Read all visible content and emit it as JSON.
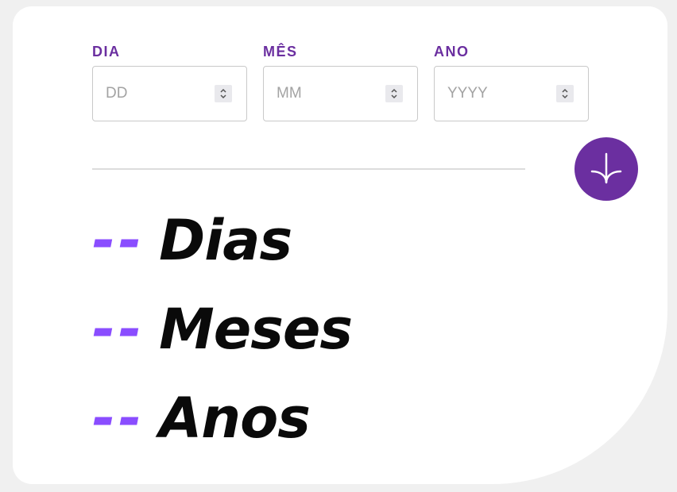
{
  "form": {
    "fields": [
      {
        "label": "DIA",
        "placeholder": "DD",
        "value": ""
      },
      {
        "label": "MÊS",
        "placeholder": "MM",
        "value": ""
      },
      {
        "label": "ANO",
        "placeholder": "YYYY",
        "value": ""
      }
    ],
    "submit_icon": "arrow-down-icon"
  },
  "results": {
    "days": {
      "value": "--",
      "unit": "Dias"
    },
    "months": {
      "value": "--",
      "unit": "Meses"
    },
    "years": {
      "value": "--",
      "unit": "Anos"
    }
  },
  "colors": {
    "accent": "#6b2fa0",
    "number": "#8a4dff",
    "text": "#0a0a0a",
    "background": "#f0f0f0",
    "card": "#ffffff"
  }
}
